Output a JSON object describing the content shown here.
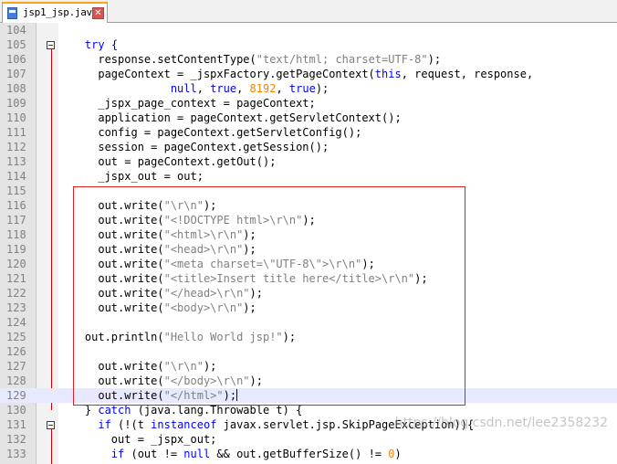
{
  "tab": {
    "label": "jsp1_jsp.java"
  },
  "lines": [
    {
      "n": "104",
      "tokens": [
        [
          "",
          ""
        ]
      ]
    },
    {
      "n": "105",
      "fold": true,
      "tokens": [
        [
          "    ",
          ""
        ],
        [
          "try",
          "kw"
        ],
        [
          " {",
          "op"
        ]
      ]
    },
    {
      "n": "106",
      "tokens": [
        [
          "      response.setContentType(",
          ""
        ],
        [
          "\"text/html; charset=UTF-8\"",
          "str"
        ],
        [
          ");",
          ""
        ]
      ]
    },
    {
      "n": "107",
      "tokens": [
        [
          "      pageContext = _jspxFactory.getPageContext(",
          ""
        ],
        [
          "this",
          "kw"
        ],
        [
          ", request, response,",
          ""
        ]
      ]
    },
    {
      "n": "108",
      "tokens": [
        [
          "                 ",
          ""
        ],
        [
          "null",
          "kw"
        ],
        [
          ", ",
          ""
        ],
        [
          "true",
          "kw"
        ],
        [
          ", ",
          ""
        ],
        [
          "8192",
          "num"
        ],
        [
          ", ",
          ""
        ],
        [
          "true",
          "kw"
        ],
        [
          ");",
          ""
        ]
      ]
    },
    {
      "n": "109",
      "tokens": [
        [
          "      _jspx_page_context = pageContext;",
          ""
        ]
      ]
    },
    {
      "n": "110",
      "tokens": [
        [
          "      application = pageContext.getServletContext();",
          ""
        ]
      ]
    },
    {
      "n": "111",
      "tokens": [
        [
          "      config = pageContext.getServletConfig();",
          ""
        ]
      ]
    },
    {
      "n": "112",
      "tokens": [
        [
          "      session = pageContext.getSession();",
          ""
        ]
      ]
    },
    {
      "n": "113",
      "tokens": [
        [
          "      out = pageContext.getOut();",
          ""
        ]
      ]
    },
    {
      "n": "114",
      "tokens": [
        [
          "      _jspx_out = out;",
          ""
        ]
      ]
    },
    {
      "n": "115",
      "tokens": [
        [
          "",
          ""
        ]
      ]
    },
    {
      "n": "116",
      "tokens": [
        [
          "      out.write(",
          ""
        ],
        [
          "\"\\r\\n\"",
          "str"
        ],
        [
          ");",
          ""
        ]
      ]
    },
    {
      "n": "117",
      "tokens": [
        [
          "      out.write(",
          ""
        ],
        [
          "\"<!DOCTYPE html>\\r\\n\"",
          "str"
        ],
        [
          ");",
          ""
        ]
      ]
    },
    {
      "n": "118",
      "tokens": [
        [
          "      out.write(",
          ""
        ],
        [
          "\"<html>\\r\\n\"",
          "str"
        ],
        [
          ");",
          ""
        ]
      ]
    },
    {
      "n": "119",
      "tokens": [
        [
          "      out.write(",
          ""
        ],
        [
          "\"<head>\\r\\n\"",
          "str"
        ],
        [
          ");",
          ""
        ]
      ]
    },
    {
      "n": "120",
      "tokens": [
        [
          "      out.write(",
          ""
        ],
        [
          "\"<meta charset=\\\"UTF-8\\\">\\r\\n\"",
          "str"
        ],
        [
          ");",
          ""
        ]
      ]
    },
    {
      "n": "121",
      "tokens": [
        [
          "      out.write(",
          ""
        ],
        [
          "\"<title>Insert title here</title>\\r\\n\"",
          "str"
        ],
        [
          ");",
          ""
        ]
      ]
    },
    {
      "n": "122",
      "tokens": [
        [
          "      out.write(",
          ""
        ],
        [
          "\"</head>\\r\\n\"",
          "str"
        ],
        [
          ");",
          ""
        ]
      ]
    },
    {
      "n": "123",
      "tokens": [
        [
          "      out.write(",
          ""
        ],
        [
          "\"<body>\\r\\n\"",
          "str"
        ],
        [
          ");",
          ""
        ]
      ]
    },
    {
      "n": "124",
      "tokens": [
        [
          "",
          ""
        ]
      ]
    },
    {
      "n": "125",
      "tokens": [
        [
          "    out.println(",
          ""
        ],
        [
          "\"Hello World jsp!\"",
          "str"
        ],
        [
          ");",
          ""
        ]
      ]
    },
    {
      "n": "126",
      "tokens": [
        [
          "",
          ""
        ]
      ]
    },
    {
      "n": "127",
      "tokens": [
        [
          "      out.write(",
          ""
        ],
        [
          "\"\\r\\n\"",
          "str"
        ],
        [
          ");",
          ""
        ]
      ]
    },
    {
      "n": "128",
      "tokens": [
        [
          "      out.write(",
          ""
        ],
        [
          "\"</body>\\r\\n\"",
          "str"
        ],
        [
          ");",
          ""
        ]
      ]
    },
    {
      "n": "129",
      "current": true,
      "caret": true,
      "tokens": [
        [
          "      out.write(",
          ""
        ],
        [
          "\"</html>\"",
          "str"
        ],
        [
          ");",
          ""
        ]
      ]
    },
    {
      "n": "130",
      "tokens": [
        [
          "    } ",
          ""
        ],
        [
          "catch",
          "kw"
        ],
        [
          " (java.lang.Throwable t) {",
          ""
        ]
      ]
    },
    {
      "n": "131",
      "fold": true,
      "tokens": [
        [
          "      ",
          ""
        ],
        [
          "if",
          "kw"
        ],
        [
          " (!(t ",
          ""
        ],
        [
          "instanceof",
          "kw"
        ],
        [
          " javax.servlet.jsp.SkipPageException)){",
          ""
        ]
      ]
    },
    {
      "n": "132",
      "tokens": [
        [
          "        out = _jspx_out;",
          ""
        ]
      ]
    },
    {
      "n": "133",
      "tokens": [
        [
          "        ",
          ""
        ],
        [
          "if",
          "kw"
        ],
        [
          " (out != ",
          ""
        ],
        [
          "null",
          "kw"
        ],
        [
          " && out.getBufferSize() != ",
          ""
        ],
        [
          "0",
          "num"
        ],
        [
          ")",
          ""
        ]
      ]
    }
  ],
  "watermark": "https://blog.csdn.net/lee2358232",
  "colors": {
    "keyword": "#0000ff",
    "string": "#808080",
    "number": "#ff8000",
    "highlight_box": "#e02020"
  }
}
